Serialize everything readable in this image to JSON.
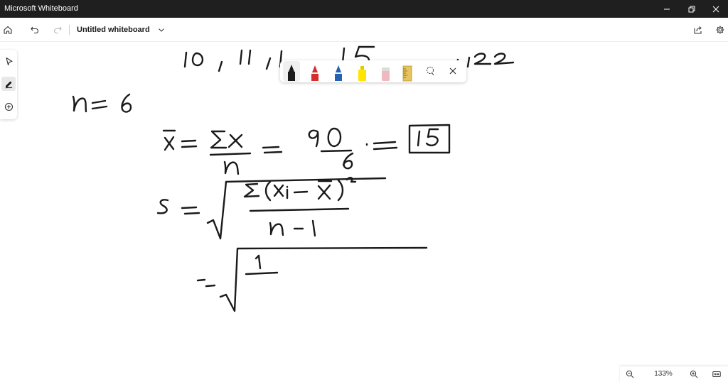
{
  "window": {
    "app_title": "Microsoft Whiteboard"
  },
  "appbar": {
    "board_title": "Untitled whiteboard"
  },
  "left_toolbar": {
    "items": [
      {
        "icon": "select-arrow-icon"
      },
      {
        "icon": "pen-icon",
        "active": true
      },
      {
        "icon": "add-icon"
      }
    ]
  },
  "pen_toolbar": {
    "tools": [
      {
        "name": "black-pen",
        "color": "#1a1a1a"
      },
      {
        "name": "red-pen",
        "color": "#d42e2e"
      },
      {
        "name": "blue-pen",
        "color": "#2463b3"
      },
      {
        "name": "highlighter",
        "color": "#ffe600"
      },
      {
        "name": "eraser",
        "color": "#f2b8c0"
      },
      {
        "name": "ruler",
        "color": "#e6c35c"
      }
    ],
    "lasso_icon": "lasso-select-icon",
    "close_icon": "close-icon"
  },
  "zoom": {
    "level": "133%"
  },
  "colors": {
    "titlebar": "#1f1f1f",
    "ink": "#1a1a1a"
  }
}
